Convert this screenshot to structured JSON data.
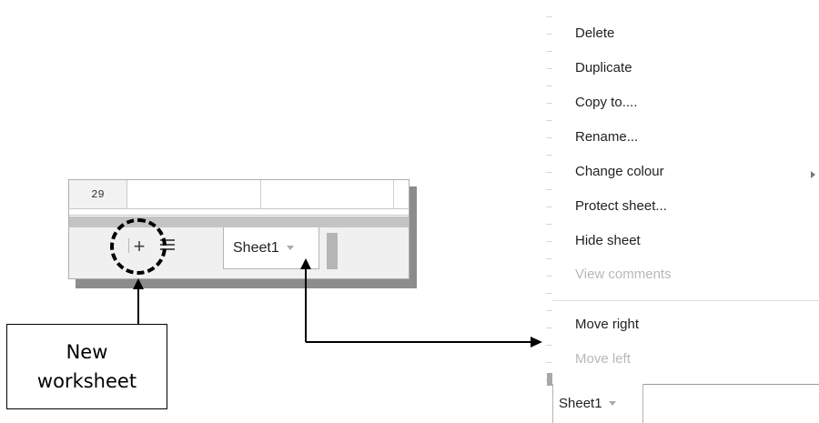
{
  "spreadsheet": {
    "row_number": "29",
    "sheet_tab_label": "Sheet1",
    "add_sheet_symbol": "+"
  },
  "callout": {
    "line1": "New",
    "line2": "worksheet"
  },
  "context_menu": {
    "items": [
      {
        "label": "Delete",
        "enabled": true
      },
      {
        "label": "Duplicate",
        "enabled": true
      },
      {
        "label": "Copy to....",
        "enabled": true
      },
      {
        "label": "Rename...",
        "enabled": true
      },
      {
        "label": "Change colour",
        "enabled": true,
        "has_submenu": true
      },
      {
        "label": "Protect sheet...",
        "enabled": true
      },
      {
        "label": "Hide sheet",
        "enabled": true
      },
      {
        "label": "View comments",
        "enabled": false
      },
      {
        "label": "Move right",
        "enabled": true
      },
      {
        "label": "Move left",
        "enabled": false
      }
    ],
    "bottom_tab_label": "Sheet1"
  },
  "icons": [
    "add-sheet-icon",
    "all-sheets-list-icon",
    "tab-dropdown-caret-icon",
    "submenu-arrow-icon",
    "arrow-head-icon"
  ],
  "colors": {
    "disabled_text": "#b8b8b8",
    "tabbar_bg": "#f0f0f0",
    "scroll_band": "#c4c4c4"
  }
}
